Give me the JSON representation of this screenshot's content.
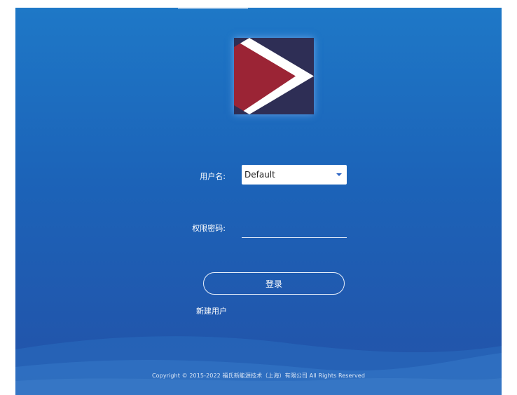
{
  "login": {
    "username_label": "用户名:",
    "username_value": "Default",
    "password_label": "权限密码:",
    "password_value": "",
    "login_button": "登录",
    "new_user_link": "新建用户"
  },
  "footer": {
    "copyright": "Copyright © 2015-2022 福氏新能源技术（上海）有限公司 All Rights Reserved"
  },
  "icons": {
    "dropdown": "caret-down-icon",
    "logo": "brand-logo"
  },
  "colors": {
    "background_top": "#1e78c7",
    "background_bottom": "#2352a8",
    "logo_red": "#9b2435",
    "logo_navy": "#2e2e55"
  }
}
